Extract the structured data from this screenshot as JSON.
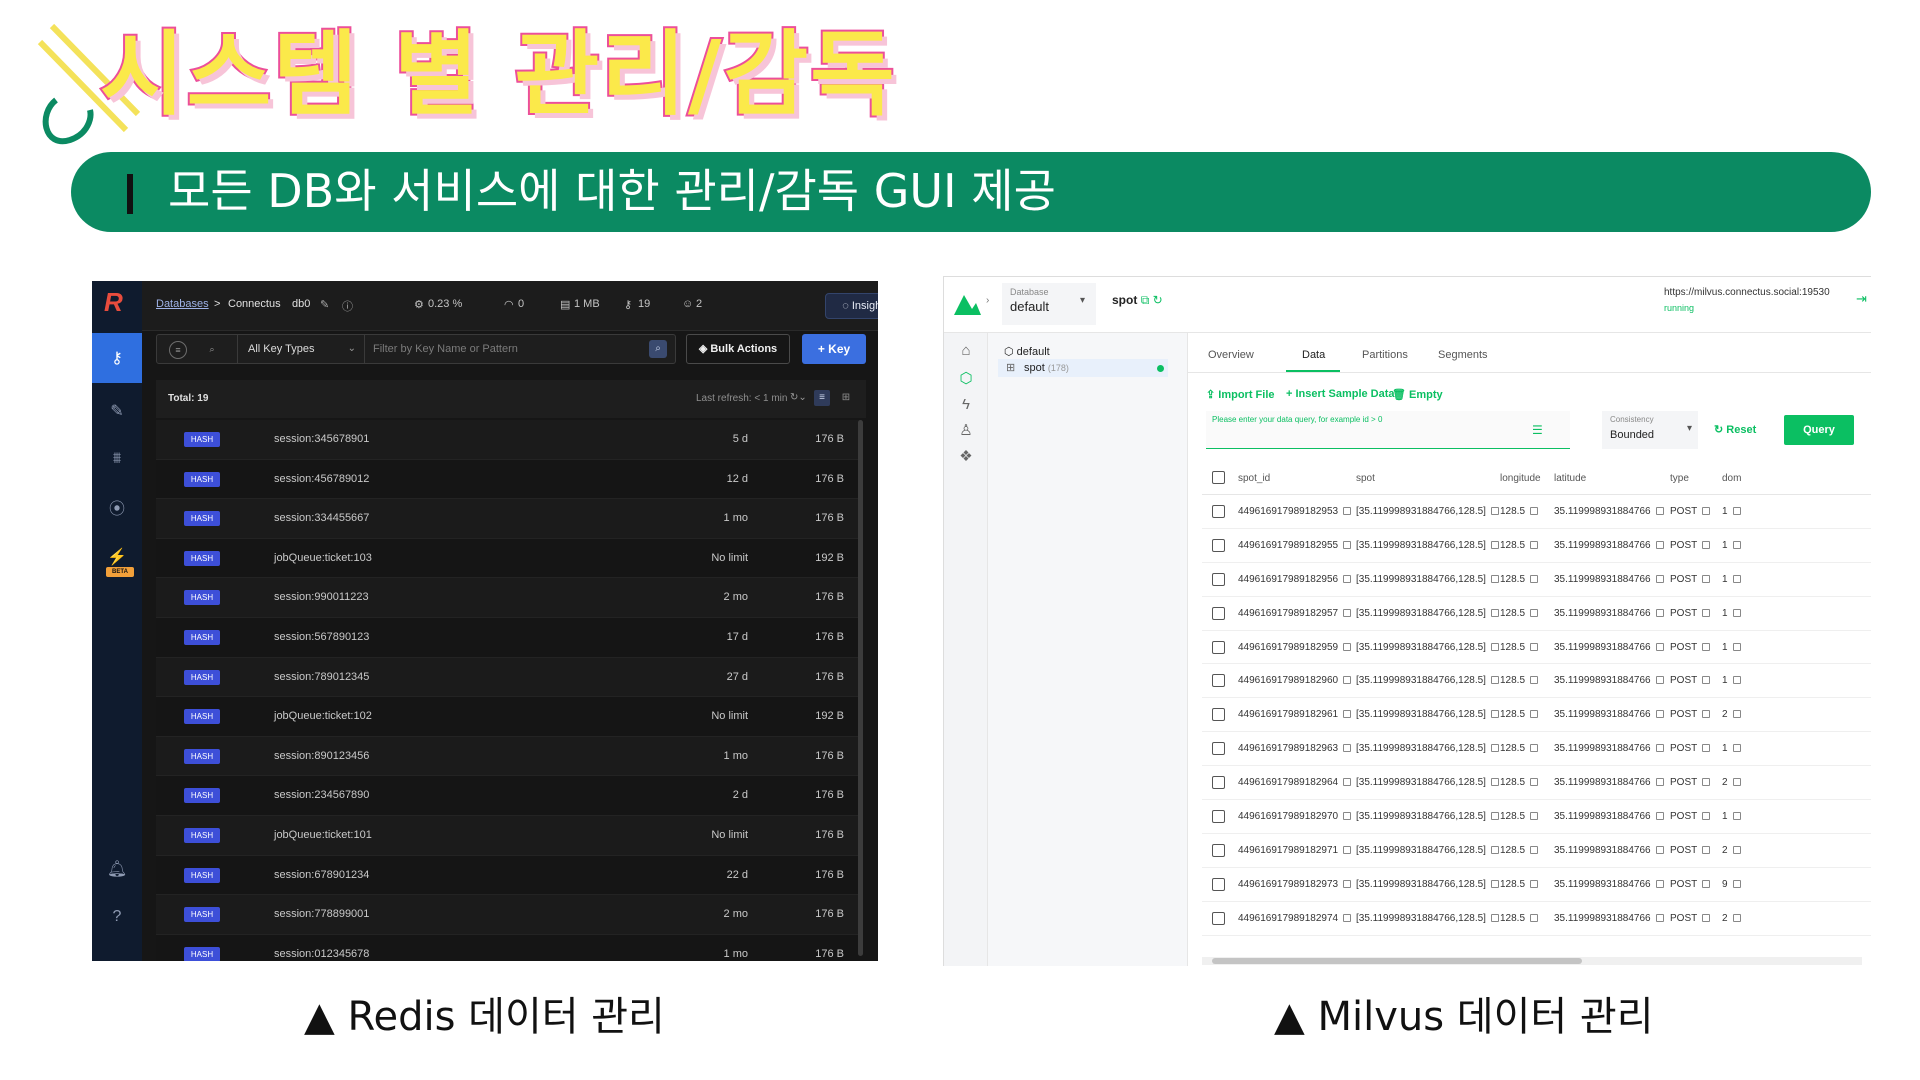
{
  "slide": {
    "title": "시스템 별 관리/감독",
    "banner": "모든 DB와 서비스에 대한 관리/감독 GUI 제공",
    "caption_left": "▲ Redis 데이터 관리",
    "caption_right": "▲ Milvus 데이터 관리",
    "colors": {
      "banner": "#0b8a62",
      "title_fill": "#fbe94a",
      "title_stroke": "#ec4f9a"
    }
  },
  "redis": {
    "breadcrumb": {
      "databases": "Databases",
      "sep": ">",
      "name": "Connectus",
      "db": "db0"
    },
    "stats": {
      "cpu": "0.23 %",
      "ops": "0",
      "memory": "1 MB",
      "keys": "19",
      "clients": "2"
    },
    "insights_label": "Insights",
    "key_types_label": "All Key Types",
    "search_placeholder": "Filter by Key Name or Pattern",
    "bulk_actions_label": "Bulk Actions",
    "add_key_label": "+ Key",
    "total": "Total: 19",
    "last_refresh": "Last refresh: < 1 min",
    "rows": [
      {
        "type": "HASH",
        "key": "session:345678901",
        "ttl": "5 d",
        "size": "176 B"
      },
      {
        "type": "HASH",
        "key": "session:456789012",
        "ttl": "12 d",
        "size": "176 B"
      },
      {
        "type": "HASH",
        "key": "session:334455667",
        "ttl": "1 mo",
        "size": "176 B"
      },
      {
        "type": "HASH",
        "key": "jobQueue:ticket:103",
        "ttl": "No limit",
        "size": "192 B"
      },
      {
        "type": "HASH",
        "key": "session:990011223",
        "ttl": "2 mo",
        "size": "176 B"
      },
      {
        "type": "HASH",
        "key": "session:567890123",
        "ttl": "17 d",
        "size": "176 B"
      },
      {
        "type": "HASH",
        "key": "session:789012345",
        "ttl": "27 d",
        "size": "176 B"
      },
      {
        "type": "HASH",
        "key": "jobQueue:ticket:102",
        "ttl": "No limit",
        "size": "192 B"
      },
      {
        "type": "HASH",
        "key": "session:890123456",
        "ttl": "1 mo",
        "size": "176 B"
      },
      {
        "type": "HASH",
        "key": "session:234567890",
        "ttl": "2 d",
        "size": "176 B"
      },
      {
        "type": "HASH",
        "key": "jobQueue:ticket:101",
        "ttl": "No limit",
        "size": "176 B"
      },
      {
        "type": "HASH",
        "key": "session:678901234",
        "ttl": "22 d",
        "size": "176 B"
      },
      {
        "type": "HASH",
        "key": "session:778899001",
        "ttl": "2 mo",
        "size": "176 B"
      },
      {
        "type": "HASH",
        "key": "session:012345678",
        "ttl": "1 mo",
        "size": "176 B"
      }
    ],
    "beta_label": "BETA"
  },
  "milvus": {
    "database_label": "Database",
    "database_value": "default",
    "collection": "spot",
    "server_url": "https://milvus.connectus.social:19530",
    "server_status": "running",
    "tree": {
      "db": "default",
      "collection": "spot",
      "count": "(178)"
    },
    "tabs": [
      "Overview",
      "Data",
      "Partitions",
      "Segments"
    ],
    "actions": {
      "import": "Import File",
      "sample": "Insert Sample Data",
      "empty": "Empty"
    },
    "query_hint": "Please enter your data query, for example id > 0",
    "consistency_label": "Consistency",
    "consistency_value": "Bounded",
    "reset_label": "Reset",
    "query_label": "Query",
    "columns": [
      "spot_id",
      "spot",
      "longitude",
      "latitude",
      "type",
      "dom"
    ],
    "rows": [
      {
        "spot_id": "449616917989182953",
        "spot": "[35.119998931884766,128.5]",
        "longitude": "128.5",
        "latitude": "35.119998931884766",
        "type": "POST",
        "dom": "1"
      },
      {
        "spot_id": "449616917989182955",
        "spot": "[35.119998931884766,128.5]",
        "longitude": "128.5",
        "latitude": "35.119998931884766",
        "type": "POST",
        "dom": "1"
      },
      {
        "spot_id": "449616917989182956",
        "spot": "[35.119998931884766,128.5]",
        "longitude": "128.5",
        "latitude": "35.119998931884766",
        "type": "POST",
        "dom": "1"
      },
      {
        "spot_id": "449616917989182957",
        "spot": "[35.119998931884766,128.5]",
        "longitude": "128.5",
        "latitude": "35.119998931884766",
        "type": "POST",
        "dom": "1"
      },
      {
        "spot_id": "449616917989182959",
        "spot": "[35.119998931884766,128.5]",
        "longitude": "128.5",
        "latitude": "35.119998931884766",
        "type": "POST",
        "dom": "1"
      },
      {
        "spot_id": "449616917989182960",
        "spot": "[35.119998931884766,128.5]",
        "longitude": "128.5",
        "latitude": "35.119998931884766",
        "type": "POST",
        "dom": "1"
      },
      {
        "spot_id": "449616917989182961",
        "spot": "[35.119998931884766,128.5]",
        "longitude": "128.5",
        "latitude": "35.119998931884766",
        "type": "POST",
        "dom": "2"
      },
      {
        "spot_id": "449616917989182963",
        "spot": "[35.119998931884766,128.5]",
        "longitude": "128.5",
        "latitude": "35.119998931884766",
        "type": "POST",
        "dom": "1"
      },
      {
        "spot_id": "449616917989182964",
        "spot": "[35.119998931884766,128.5]",
        "longitude": "128.5",
        "latitude": "35.119998931884766",
        "type": "POST",
        "dom": "2"
      },
      {
        "spot_id": "449616917989182970",
        "spot": "[35.119998931884766,128.5]",
        "longitude": "128.5",
        "latitude": "35.119998931884766",
        "type": "POST",
        "dom": "1"
      },
      {
        "spot_id": "449616917989182971",
        "spot": "[35.119998931884766,128.5]",
        "longitude": "128.5",
        "latitude": "35.119998931884766",
        "type": "POST",
        "dom": "2"
      },
      {
        "spot_id": "449616917989182973",
        "spot": "[35.119998931884766,128.5]",
        "longitude": "128.5",
        "latitude": "35.119998931884766",
        "type": "POST",
        "dom": "9"
      },
      {
        "spot_id": "449616917989182974",
        "spot": "[35.119998931884766,128.5]",
        "longitude": "128.5",
        "latitude": "35.119998931884766",
        "type": "POST",
        "dom": "2"
      }
    ]
  }
}
